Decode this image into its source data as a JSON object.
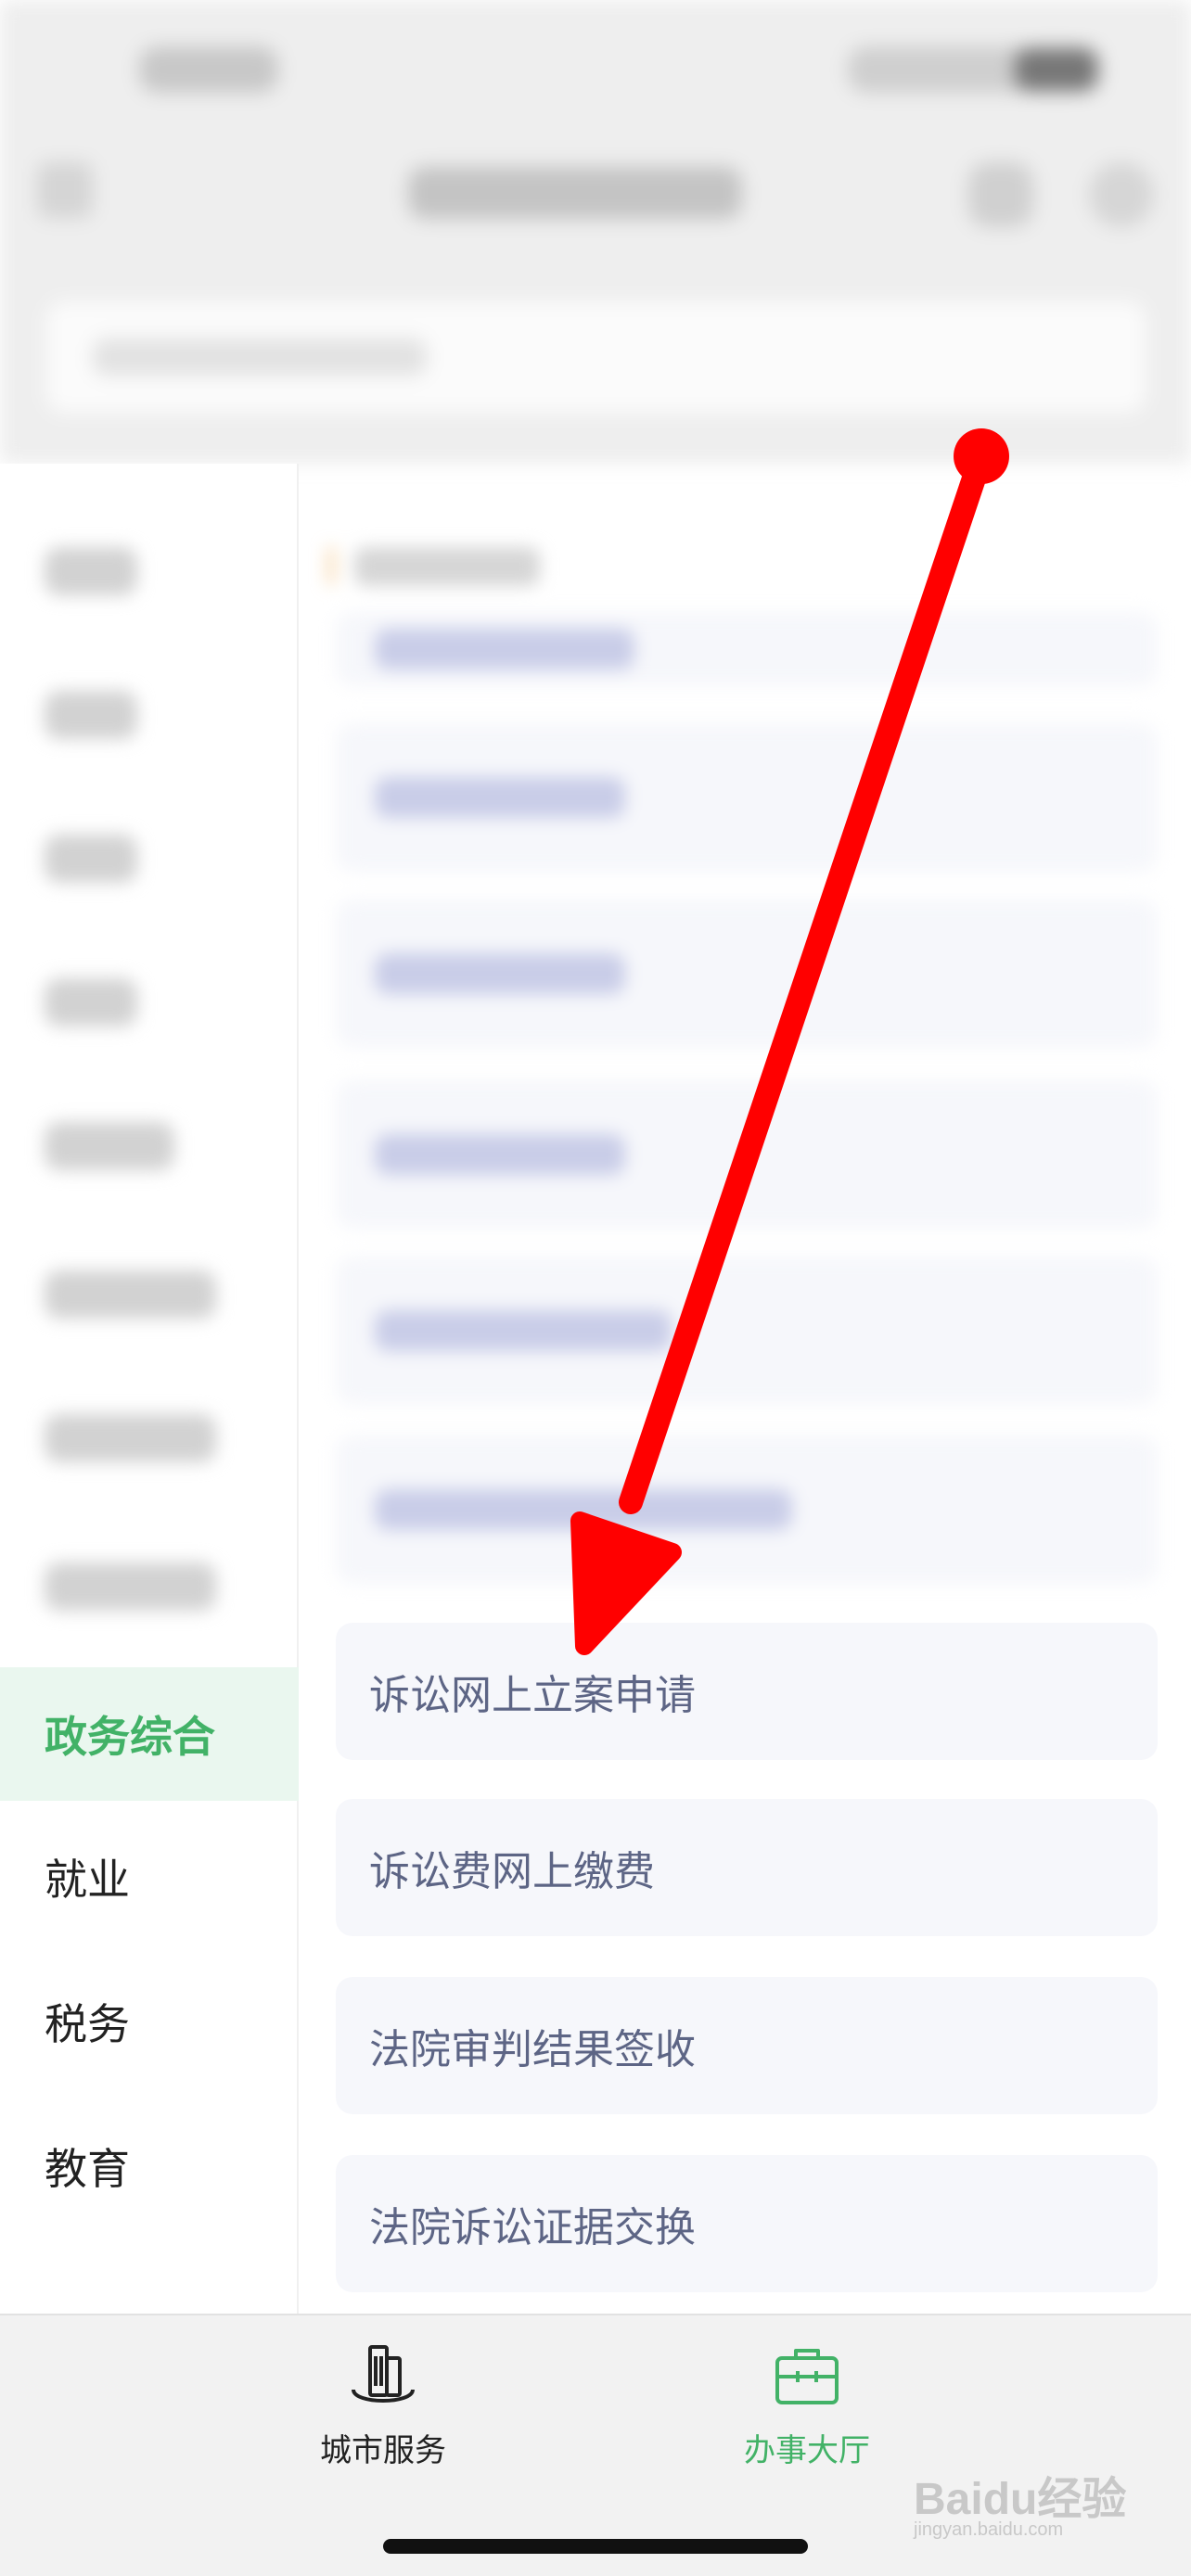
{
  "sidebar": {
    "items": [
      {
        "label": "政务综合",
        "active": true
      },
      {
        "label": "就业"
      },
      {
        "label": "税务"
      },
      {
        "label": "教育"
      }
    ]
  },
  "services": [
    {
      "label": "诉讼网上立案申请"
    },
    {
      "label": "诉讼费网上缴费"
    },
    {
      "label": "法院审判结果签收"
    },
    {
      "label": "法院诉讼证据交换"
    }
  ],
  "tabbar": {
    "tabs": [
      {
        "label": "城市服务",
        "icon": "city-building-icon",
        "active": false
      },
      {
        "label": "办事大厅",
        "icon": "briefcase-icon",
        "active": true
      }
    ]
  },
  "watermark": {
    "text": "Baidu经验",
    "sub": "jingyan.baidu.com"
  },
  "colors": {
    "accent": "#42b267",
    "active_bg": "#eaf7ef",
    "card_bg": "#f6f7fb",
    "card_text": "#5d6585",
    "arrow": "#ff0000"
  }
}
